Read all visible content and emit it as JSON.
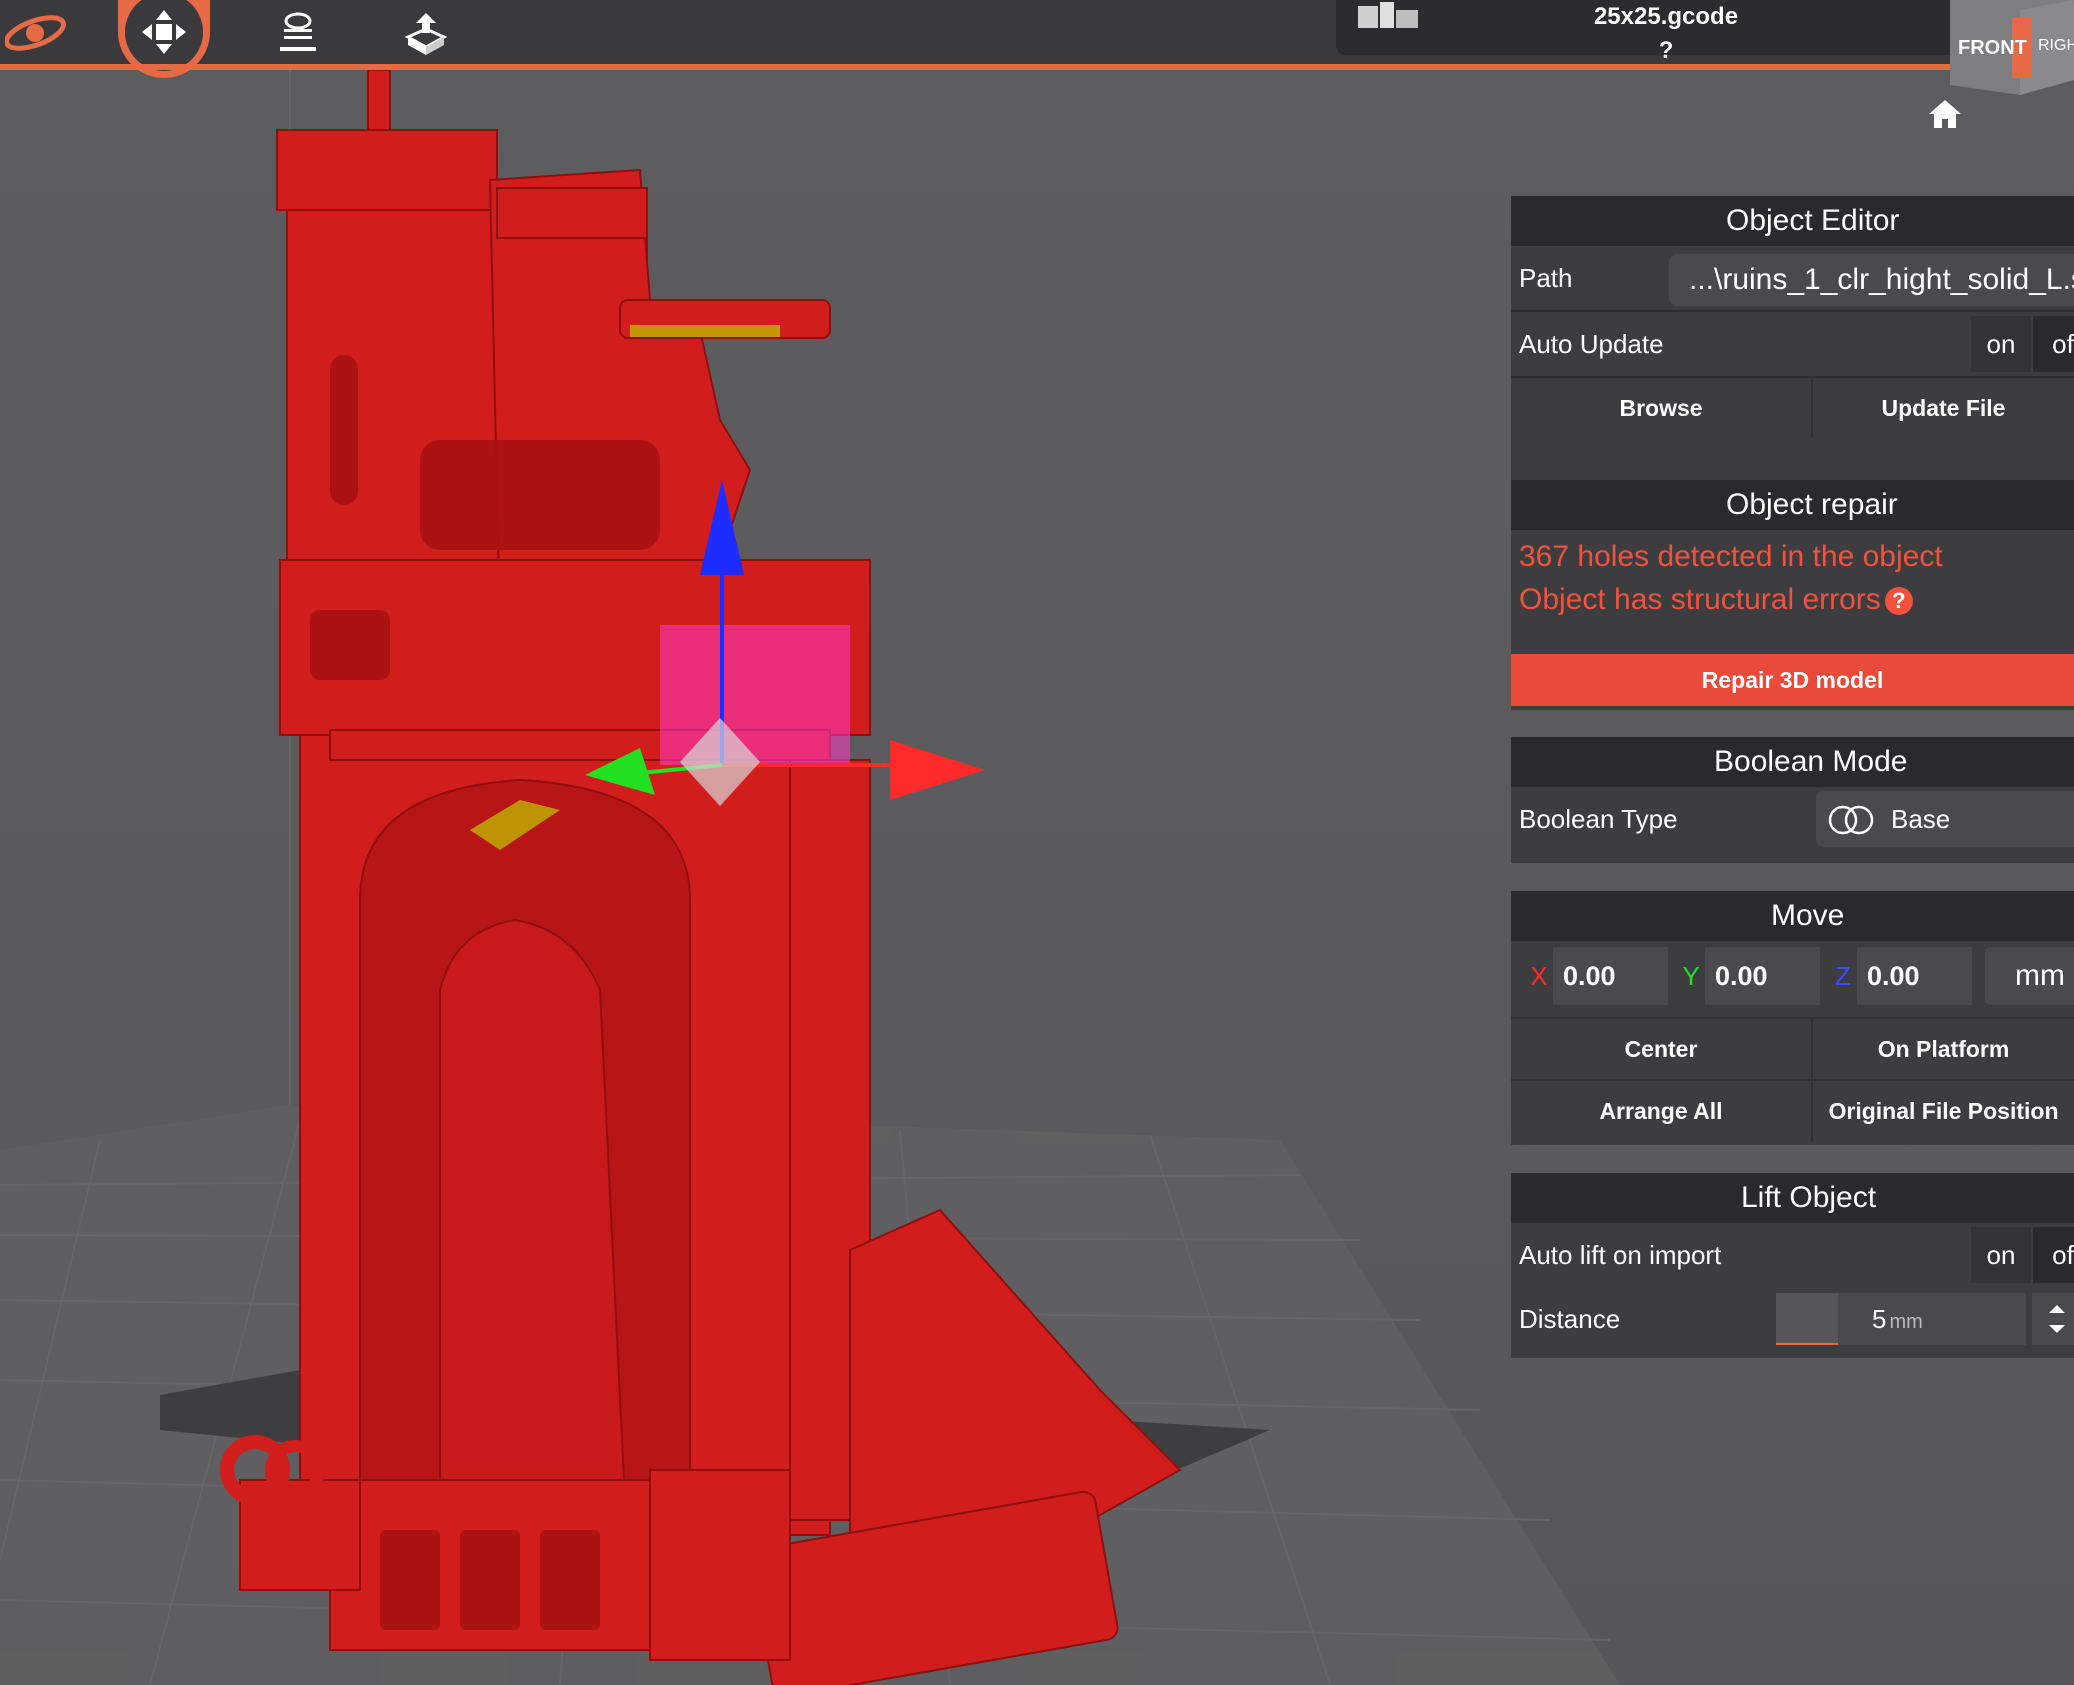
{
  "toolbar": {
    "file_name": "25x25.gcode ?",
    "view_cube": {
      "front": "FRONT",
      "right": "RIGHT"
    }
  },
  "icons": [
    "logo-icon",
    "move-icon",
    "layers-icon",
    "export-icon",
    "home-icon"
  ],
  "object_editor": {
    "title": "Object Editor",
    "path_label": "Path",
    "path_value": "...\\ruins_1_clr_hight_solid_L.s",
    "auto_update_label": "Auto Update",
    "on": "on",
    "off": "of",
    "browse": "Browse",
    "update_file": "Update File"
  },
  "object_repair": {
    "title": "Object repair",
    "holes": "367 holes detected in the object",
    "structural": "Object has structural errors",
    "help": "?",
    "repair_button": "Repair 3D model"
  },
  "boolean_mode": {
    "title": "Boolean Mode",
    "type_label": "Boolean Type",
    "type_value": "Base"
  },
  "move": {
    "title": "Move",
    "x_label": "X",
    "x_value": "0.00",
    "y_label": "Y",
    "y_value": "0.00",
    "z_label": "Z",
    "z_value": "0.00",
    "unit": "mm",
    "center": "Center",
    "on_platform": "On Platform",
    "arrange_all": "Arrange All",
    "original_position": "Original File Position"
  },
  "lift_object": {
    "title": "Lift Object",
    "auto_lift_label": "Auto lift on import",
    "on": "on",
    "off": "of",
    "distance_label": "Distance",
    "distance_value": "5",
    "distance_unit": "mm"
  },
  "colors": {
    "accent": "#e66a45",
    "error": "#f0523e",
    "repair_button": "#e84b3a",
    "model": "#d21d1d",
    "axis_x": "#ff2a2a",
    "axis_y": "#22e022",
    "axis_z": "#1e2cff"
  }
}
